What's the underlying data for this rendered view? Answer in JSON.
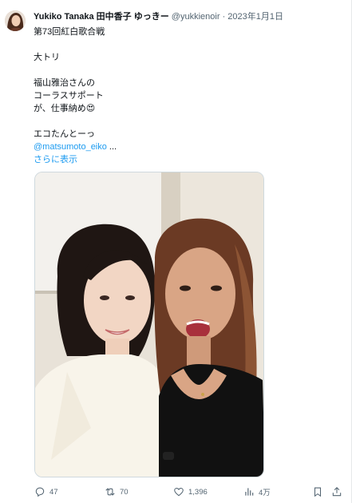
{
  "tweet": {
    "display_name": "Yukiko Tanaka 田中香子 ゆっきー",
    "handle": "@yukkienoir",
    "separator": "·",
    "date": "2023年1月1日",
    "lines": [
      "第73回紅白歌合戦",
      "",
      "大トリ",
      "",
      "福山雅治さんの",
      "コーラスサポート",
      "が、仕事納め😍",
      "",
      "エコたんとーっ"
    ],
    "mention": "@matsumoto_eiko",
    "ellipsis": " ...",
    "show_more": "さらに表示"
  },
  "actions": {
    "reply_count": "47",
    "retweet_count": "70",
    "like_count": "1,396",
    "views_count": "4万"
  },
  "icons": {
    "reply": "reply-icon",
    "retweet": "retweet-icon",
    "like": "heart-icon",
    "views": "views-icon",
    "bookmark": "bookmark-icon",
    "share": "share-icon"
  },
  "colors": {
    "link": "#1d9bf0",
    "secondary_text": "#536471",
    "primary_text": "#0f1419"
  }
}
